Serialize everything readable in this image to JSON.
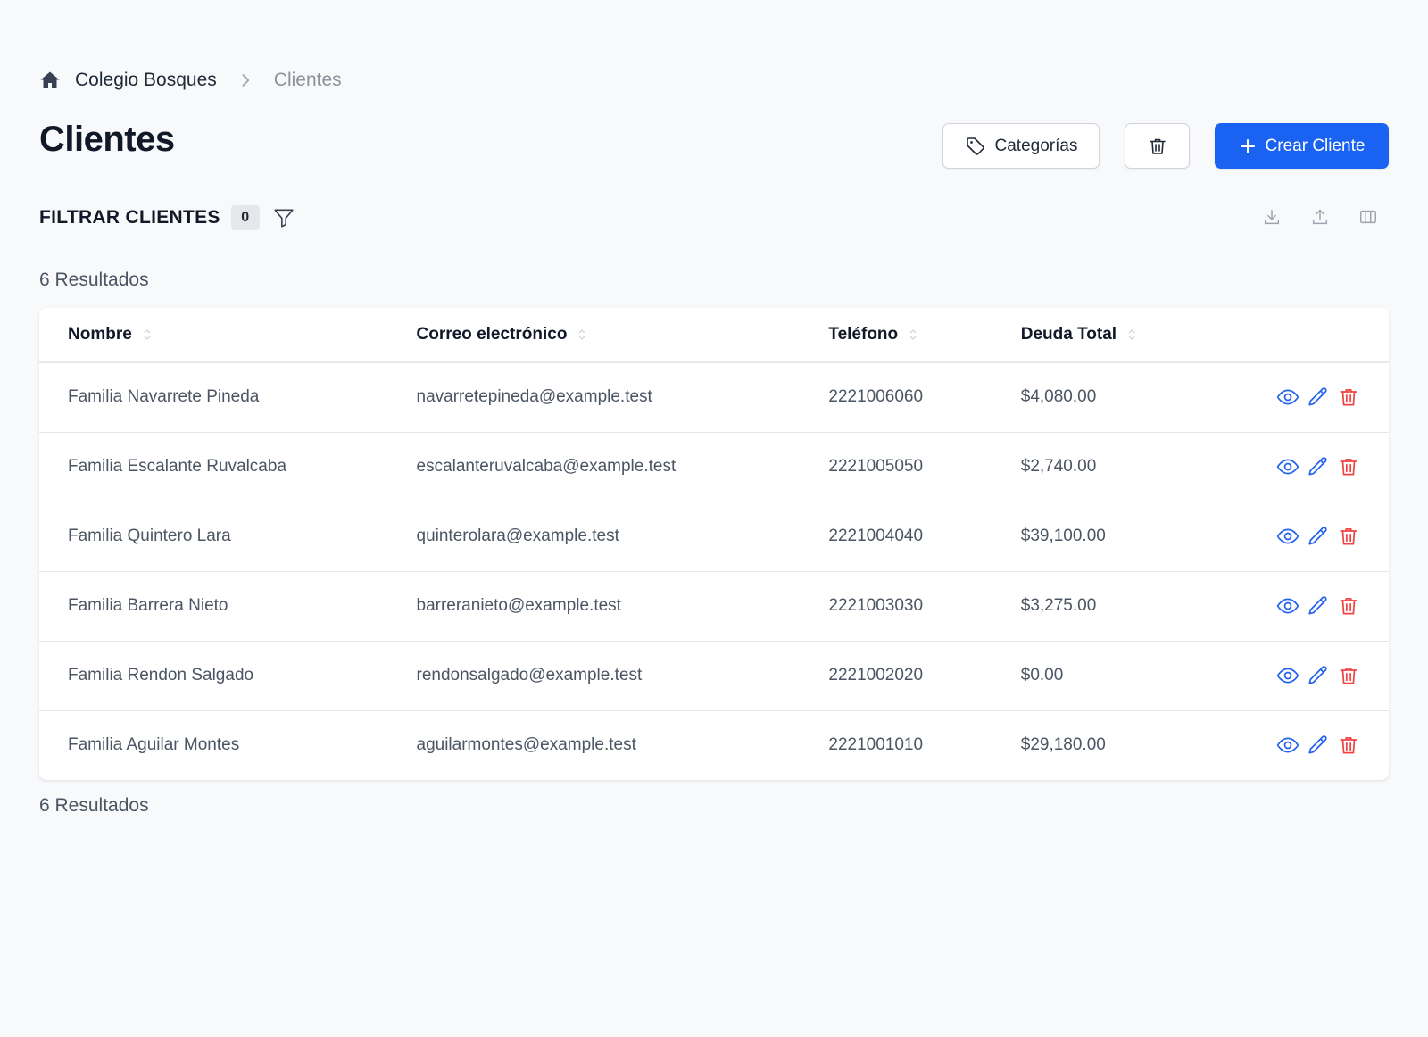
{
  "breadcrumb": {
    "root": "Colegio Bosques",
    "current": "Clientes"
  },
  "page": {
    "title": "Clientes"
  },
  "header_actions": {
    "categories_label": "Categorías",
    "create_label": "Crear Cliente"
  },
  "filter": {
    "title": "FILTRAR CLIENTES",
    "count": "0"
  },
  "results": {
    "top": "6 Resultados",
    "bottom": "6 Resultados"
  },
  "table": {
    "columns": [
      "Nombre",
      "Correo electrónico",
      "Teléfono",
      "Deuda Total"
    ],
    "rows": [
      {
        "name": "Familia Navarrete Pineda",
        "email": "navarretepineda@example.test",
        "phone": "2221006060",
        "debt": "$4,080.00"
      },
      {
        "name": "Familia Escalante Ruvalcaba",
        "email": "escalanteruvalcaba@example.test",
        "phone": "2221005050",
        "debt": "$2,740.00"
      },
      {
        "name": "Familia Quintero Lara",
        "email": "quinterolara@example.test",
        "phone": "2221004040",
        "debt": "$39,100.00"
      },
      {
        "name": "Familia Barrera Nieto",
        "email": "barreranieto@example.test",
        "phone": "2221003030",
        "debt": "$3,275.00"
      },
      {
        "name": "Familia Rendon Salgado",
        "email": "rendonsalgado@example.test",
        "phone": "2221002020",
        "debt": "$0.00"
      },
      {
        "name": "Familia Aguilar Montes",
        "email": "aguilarmontes@example.test",
        "phone": "2221001010",
        "debt": "$29,180.00"
      }
    ]
  },
  "icons": {
    "home": "home-icon",
    "chevron": "chevron-right-icon",
    "tag": "tag-icon",
    "trash": "trash-icon",
    "plus": "plus-icon",
    "filter": "filter-icon",
    "download": "download-icon",
    "upload": "upload-icon",
    "columns": "columns-icon",
    "view": "eye-icon",
    "edit": "pencil-icon",
    "delete": "trash-icon"
  },
  "colors": {
    "primary": "#1a62f2",
    "action_blue": "#2563eb",
    "danger": "#ef4444",
    "background": "#f8f9fb"
  }
}
